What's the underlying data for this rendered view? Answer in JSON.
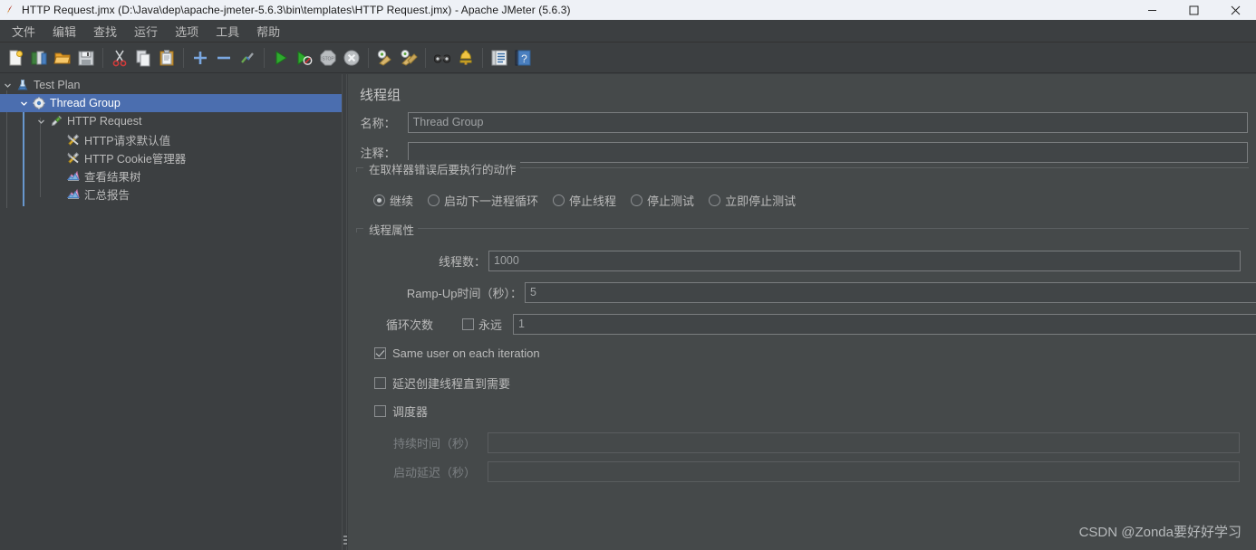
{
  "window": {
    "title": "HTTP Request.jmx (D:\\Java\\dep\\apache-jmeter-5.6.3\\bin\\templates\\HTTP Request.jmx) - Apache JMeter (5.6.3)",
    "app_icon": "jmeter-feather-icon",
    "controls": {
      "minimize": "minimize-icon",
      "maximize": "maximize-icon",
      "close": "close-icon"
    }
  },
  "menubar": {
    "items": [
      {
        "label": "文件",
        "name": "menu-file"
      },
      {
        "label": "编辑",
        "name": "menu-edit"
      },
      {
        "label": "查找",
        "name": "menu-search"
      },
      {
        "label": "运行",
        "name": "menu-run"
      },
      {
        "label": "选项",
        "name": "menu-options"
      },
      {
        "label": "工具",
        "name": "menu-tools"
      },
      {
        "label": "帮助",
        "name": "menu-help"
      }
    ]
  },
  "toolbar": {
    "buttons": [
      {
        "icon": "new-document-icon",
        "name": "toolbar-new"
      },
      {
        "icon": "templates-icon",
        "name": "toolbar-templates"
      },
      {
        "icon": "open-folder-icon",
        "name": "toolbar-open"
      },
      {
        "icon": "save-icon",
        "name": "toolbar-save"
      },
      {
        "sep": true
      },
      {
        "icon": "cut-scissors-icon",
        "name": "toolbar-cut"
      },
      {
        "icon": "copy-icon",
        "name": "toolbar-copy"
      },
      {
        "icon": "paste-clipboard-icon",
        "name": "toolbar-paste"
      },
      {
        "sep": true
      },
      {
        "icon": "expand-plus-icon",
        "name": "toolbar-expand-all"
      },
      {
        "icon": "collapse-minus-icon",
        "name": "toolbar-collapse-all"
      },
      {
        "icon": "toggle-enable-icon",
        "name": "toolbar-toggle"
      },
      {
        "sep": true
      },
      {
        "icon": "start-play-icon",
        "name": "toolbar-start"
      },
      {
        "icon": "start-no-pauses-icon",
        "name": "toolbar-start-no-pauses"
      },
      {
        "icon": "stop-icon",
        "name": "toolbar-stop"
      },
      {
        "icon": "shutdown-icon",
        "name": "toolbar-shutdown"
      },
      {
        "sep": true
      },
      {
        "icon": "clear-broom-icon",
        "name": "toolbar-clear"
      },
      {
        "icon": "clear-all-broom-icon",
        "name": "toolbar-clear-all"
      },
      {
        "sep": true
      },
      {
        "icon": "search-binoculars-icon",
        "name": "toolbar-search"
      },
      {
        "icon": "reset-search-bell-icon",
        "name": "toolbar-reset-search"
      },
      {
        "sep": true
      },
      {
        "icon": "function-helper-icon",
        "name": "toolbar-function-helper"
      },
      {
        "icon": "help-question-icon",
        "name": "toolbar-help"
      }
    ]
  },
  "tree": {
    "nodes": [
      {
        "label": "Test Plan",
        "icon": "test-plan-icon",
        "indent": 0,
        "twist": "expanded",
        "selected": false,
        "name": "tree-node-test-plan"
      },
      {
        "label": "Thread Group",
        "icon": "thread-group-icon",
        "indent": 1,
        "twist": "expanded",
        "selected": true,
        "name": "tree-node-thread-group"
      },
      {
        "label": "HTTP Request",
        "icon": "http-request-icon",
        "indent": 2,
        "twist": "expanded",
        "selected": false,
        "name": "tree-node-http-request"
      },
      {
        "label": "HTTP请求默认值",
        "icon": "config-tools-icon",
        "indent": 3,
        "twist": "none",
        "selected": false,
        "name": "tree-node-http-defaults"
      },
      {
        "label": "HTTP Cookie管理器",
        "icon": "config-tools-icon",
        "indent": 3,
        "twist": "none",
        "selected": false,
        "name": "tree-node-http-cookie-manager"
      },
      {
        "label": "查看结果树",
        "icon": "listener-icon",
        "indent": 3,
        "twist": "none",
        "selected": false,
        "name": "tree-node-view-results-tree"
      },
      {
        "label": "汇总报告",
        "icon": "listener-icon",
        "indent": 3,
        "twist": "none",
        "selected": false,
        "name": "tree-node-summary-report"
      }
    ]
  },
  "main": {
    "panel_title": "线程组",
    "name_label": "名称：",
    "name_value": "Thread Group",
    "comment_label": "注释：",
    "comment_value": "",
    "comment_placeholder": "",
    "error_action": {
      "group_title": "在取样器错误后要执行的动作",
      "options": [
        {
          "label": "继续",
          "selected": true,
          "name": "radio-continue"
        },
        {
          "label": "启动下一进程循环",
          "selected": false,
          "name": "radio-start-next-loop"
        },
        {
          "label": "停止线程",
          "selected": false,
          "name": "radio-stop-thread"
        },
        {
          "label": "停止测试",
          "selected": false,
          "name": "radio-stop-test"
        },
        {
          "label": "立即停止测试",
          "selected": false,
          "name": "radio-stop-test-now"
        }
      ]
    },
    "thread_properties": {
      "group_title": "线程属性",
      "threads_label": "线程数：",
      "threads_value": "1000",
      "rampup_label": "Ramp-Up时间（秒）：",
      "rampup_value": "5",
      "loops_label": "循环次数",
      "forever_label": "永远",
      "forever_checked": false,
      "loops_value": "1",
      "same_user_label": "Same user on each iteration",
      "same_user_checked": true,
      "delay_create_label": "延迟创建线程直到需要",
      "delay_create_checked": false,
      "scheduler_label": "调度器",
      "scheduler_checked": false,
      "duration_label": "持续时间（秒）",
      "duration_value": "",
      "duration_disabled": true,
      "startup_delay_label": "启动延迟（秒）",
      "startup_delay_value": "",
      "startup_delay_disabled": true
    }
  },
  "watermark": {
    "text": "CSDN @Zonda要好好学习"
  },
  "colors": {
    "titlebar_bg": "#eef1f6",
    "chrome_bg": "#3c3f41",
    "panel_bg": "#45494a",
    "selection_blue": "#4b6eaf",
    "text": "#bbbbbb",
    "field_border": "#7a7d7f"
  }
}
